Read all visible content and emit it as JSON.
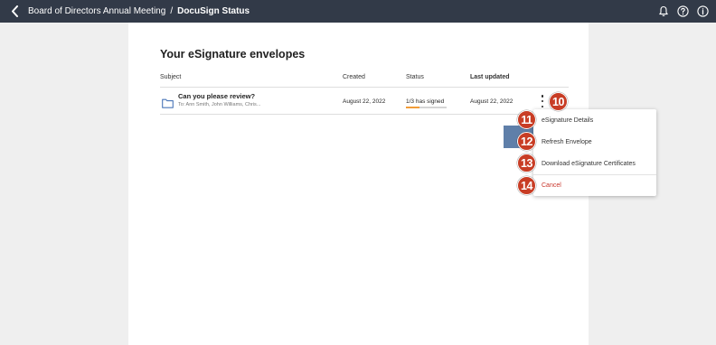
{
  "topbar": {
    "back_icon": "chevron-left-icon",
    "breadcrumb_parent": "Board of Directors Annual Meeting",
    "breadcrumb_separator": "/",
    "breadcrumb_current": "DocuSign Status",
    "icons": [
      "bell-icon",
      "help-icon",
      "info-icon"
    ]
  },
  "panel": {
    "title": "Your eSignature envelopes",
    "columns": {
      "subject": "Subject",
      "created": "Created",
      "status": "Status",
      "last_updated": "Last updated"
    },
    "row": {
      "icon": "folder-icon",
      "subject": "Can you please review?",
      "recipients": "To: Ann Smith, John Williams, Chris...",
      "created": "August 22, 2022",
      "status": "1/3 has signed",
      "status_progress": 0.33,
      "last_updated": "August 22, 2022",
      "menu_icon": "more-vertical-icon"
    }
  },
  "menu": {
    "items": [
      {
        "label": "eSignature Details",
        "badge": "11"
      },
      {
        "label": "Refresh Envelope",
        "badge": "12"
      },
      {
        "label": "Download eSignature Certificates",
        "badge": "13"
      },
      {
        "label": "Cancel",
        "badge": "14"
      }
    ]
  },
  "annotation": {
    "kebab_badge": "10",
    "badge_color": "#c83d25"
  },
  "colors": {
    "topbar": "#323a48",
    "progress_fill": "#f29c38",
    "cancel_text": "#c8352a",
    "folder": "#4a76b8"
  }
}
